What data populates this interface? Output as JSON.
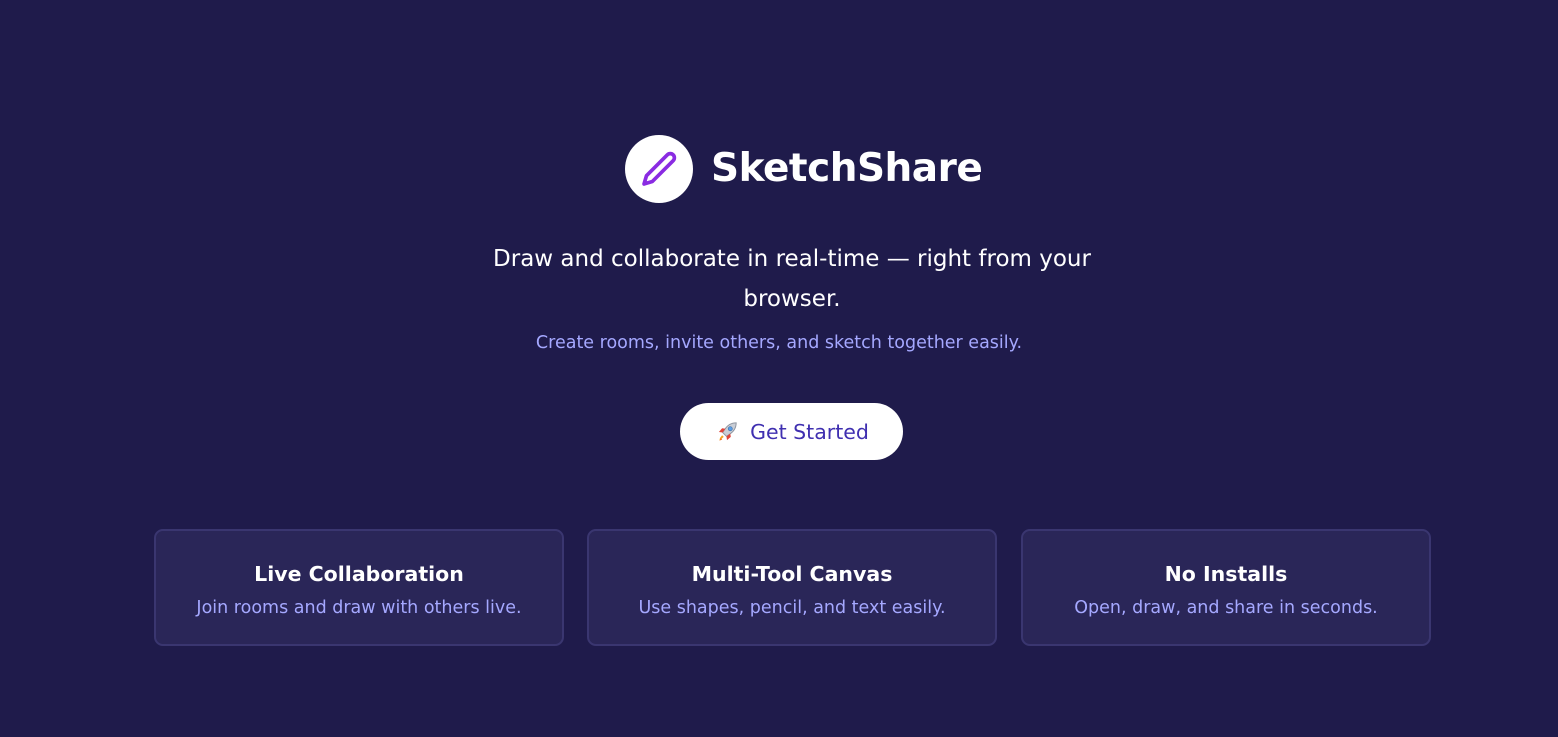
{
  "brand": {
    "name": "SketchShare",
    "logo_icon": "pencil-icon",
    "logo_color": "#8a2be2"
  },
  "hero": {
    "tagline": "Draw and collaborate in real-time — right from your browser.",
    "subtagline": "Create rooms, invite others, and sketch together easily."
  },
  "cta": {
    "icon": "rocket-icon",
    "label": "Get Started"
  },
  "features": [
    {
      "title": "Live Collaboration",
      "description": "Join rooms and draw with others live."
    },
    {
      "title": "Multi-Tool Canvas",
      "description": "Use shapes, pencil, and text easily."
    },
    {
      "title": "No Installs",
      "description": "Open, draw, and share in seconds."
    }
  ],
  "colors": {
    "background": "#1f1b4b",
    "card_background": "#2a2658",
    "card_border": "#3a3670",
    "accent_text": "#a5a8ff",
    "cta_text": "#3f2fb0"
  }
}
